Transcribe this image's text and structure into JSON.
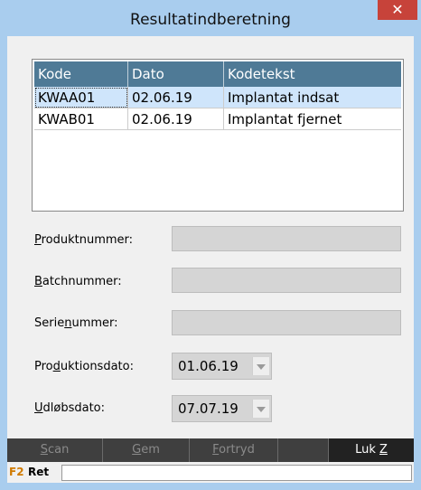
{
  "window": {
    "title": "Resultatindberetning",
    "close_glyph": "✕"
  },
  "table": {
    "headers": [
      "Kode",
      "Dato",
      "Kodetekst"
    ],
    "rows": [
      {
        "kode": "KWAA01",
        "dato": "02.06.19",
        "kodetekst": "Implantat indsat"
      },
      {
        "kode": "KWAB01",
        "dato": "02.06.19",
        "kodetekst": "Implantat fjernet"
      }
    ]
  },
  "fields": {
    "produktnummer": {
      "pre": "",
      "u": "P",
      "post": "roduktnummer:"
    },
    "batchnummer": {
      "pre": "",
      "u": "B",
      "post": "atchnummer:"
    },
    "serienummer": {
      "pre": "Serie",
      "u": "n",
      "post": "ummer:"
    },
    "produktionsdato": {
      "pre": "Pro",
      "u": "d",
      "post": "uktionsdato:",
      "value": "01.06.19"
    },
    "udlobsdato": {
      "pre": "",
      "u": "U",
      "post": "dløbsdato:",
      "value": "07.07.19"
    }
  },
  "buttons": {
    "scan": {
      "u": "S",
      "rest": "can"
    },
    "gem": {
      "u": "G",
      "rest": "em"
    },
    "fortryd": {
      "u": "F",
      "rest": "ortryd"
    },
    "luk": {
      "pre": "Luk ",
      "u": "Z"
    }
  },
  "status": {
    "key": "F2",
    "label": "Ret"
  }
}
